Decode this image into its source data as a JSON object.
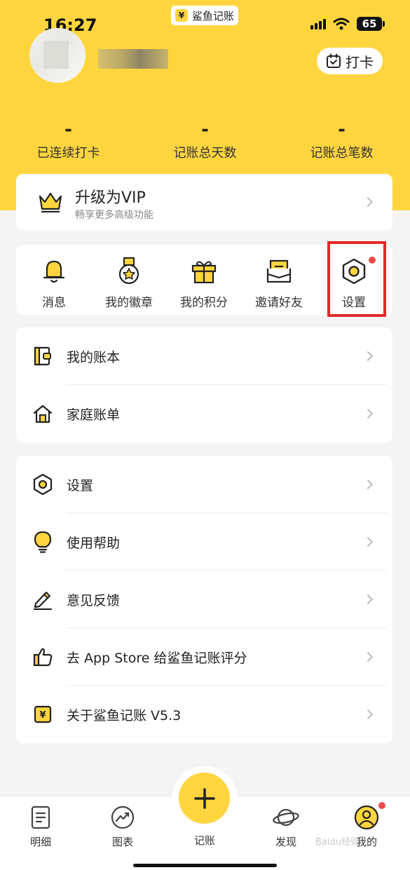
{
  "status_bar": {
    "time": "16:27",
    "battery": "65"
  },
  "app_pill": {
    "yen": "¥",
    "name": "鲨鱼记账"
  },
  "header": {
    "checkin_label": "打卡"
  },
  "stats": [
    {
      "value": "-",
      "label": "已连续打卡"
    },
    {
      "value": "-",
      "label": "记账总天数"
    },
    {
      "value": "-",
      "label": "记账总笔数"
    }
  ],
  "vip": {
    "title": "升级为VIP",
    "subtitle": "畅享更多高级功能"
  },
  "quick": [
    {
      "label": "消息",
      "icon": "bell-icon"
    },
    {
      "label": "我的徽章",
      "icon": "medal-icon"
    },
    {
      "label": "我的积分",
      "icon": "gift-icon"
    },
    {
      "label": "邀请好友",
      "icon": "envelope-icon"
    },
    {
      "label": "设置",
      "icon": "hexagon-settings-icon"
    }
  ],
  "list1": [
    {
      "label": "我的账本",
      "icon": "ledger-icon"
    },
    {
      "label": "家庭账单",
      "icon": "house-icon"
    }
  ],
  "list2": [
    {
      "label": "设置",
      "icon": "settings-icon"
    },
    {
      "label": "使用帮助",
      "icon": "lightbulb-icon"
    },
    {
      "label": "意见反馈",
      "icon": "pencil-icon"
    },
    {
      "label": "去 App Store 给鲨鱼记账评分",
      "icon": "thumbs-up-icon"
    },
    {
      "label": "关于鲨鱼记账 V5.3",
      "icon": "yen-badge-icon"
    }
  ],
  "tabs": [
    {
      "label": "明细",
      "icon": "document-icon"
    },
    {
      "label": "图表",
      "icon": "chart-icon"
    },
    {
      "label": "记账",
      "icon": "plus-icon"
    },
    {
      "label": "发现",
      "icon": "planet-icon"
    },
    {
      "label": "我的",
      "icon": "user-icon"
    }
  ],
  "watermark": "Baidu经验",
  "colors": {
    "brand_yellow": "#ffd53f",
    "badge_red": "#f04b4b",
    "highlight_red": "#e42a2a"
  }
}
